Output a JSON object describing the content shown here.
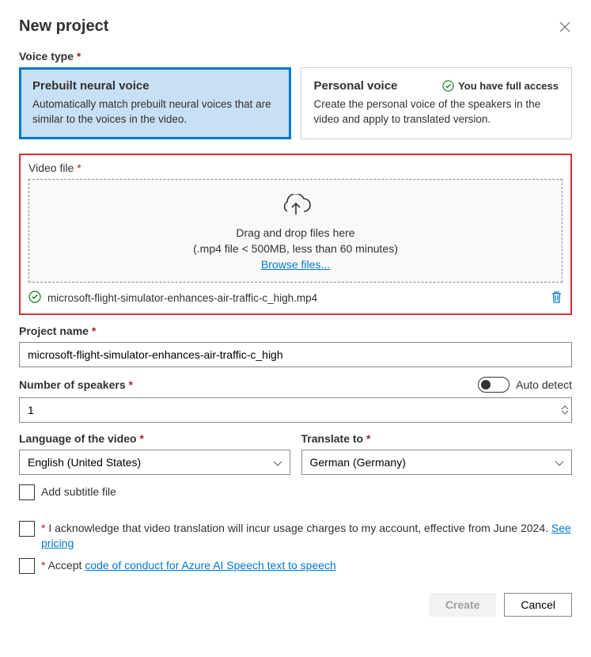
{
  "header": {
    "title": "New project"
  },
  "voiceType": {
    "label": "Voice type",
    "prebuilt": {
      "title": "Prebuilt neural voice",
      "desc": "Automatically match prebuilt neural voices that are similar to the voices in the video."
    },
    "personal": {
      "title": "Personal voice",
      "desc": "Create the personal voice of the speakers in the video and apply to translated version.",
      "badge": "You have full access"
    }
  },
  "videoFile": {
    "label": "Video file",
    "dropText": "Drag and drop files here",
    "hint": "(.mp4 file < 500MB, less than 60 minutes)",
    "browse": "Browse files...",
    "uploadedName": "microsoft-flight-simulator-enhances-air-traffic-c_high.mp4"
  },
  "projectName": {
    "label": "Project name",
    "value": "microsoft-flight-simulator-enhances-air-traffic-c_high"
  },
  "speakers": {
    "label": "Number of speakers",
    "autoDetect": "Auto detect",
    "value": "1"
  },
  "language": {
    "label": "Language of the video",
    "value": "English (United States)"
  },
  "translateTo": {
    "label": "Translate to",
    "value": "German (Germany)"
  },
  "subtitle": {
    "label": "Add subtitle file"
  },
  "acknowledge": {
    "text": "I acknowledge that video translation will incur usage charges to my account, effective from June 2024. ",
    "link": "See pricing"
  },
  "conduct": {
    "text": "Accept ",
    "link": "code of conduct for Azure AI Speech text to speech"
  },
  "buttons": {
    "create": "Create",
    "cancel": "Cancel"
  }
}
